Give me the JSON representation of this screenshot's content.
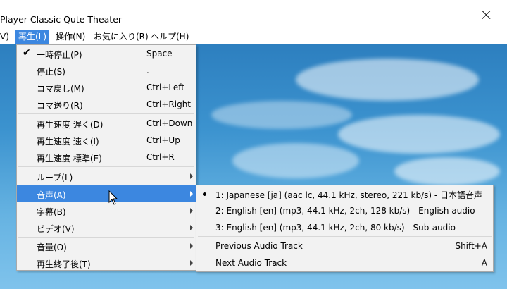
{
  "window": {
    "title": "Player Classic Qute Theater"
  },
  "menubar": {
    "items": [
      {
        "label": "V)",
        "active": false
      },
      {
        "label": "再生(L)",
        "active": true
      },
      {
        "label": "操作(N)",
        "active": false
      },
      {
        "label": "お気に入り(R)",
        "active": false
      },
      {
        "label": "ヘルプ(H)",
        "active": false
      }
    ]
  },
  "play_menu": {
    "items": [
      {
        "label": "一時停止(P)",
        "accel": "Space",
        "checked": true
      },
      {
        "label": "停止(S)",
        "accel": "."
      },
      {
        "label": "コマ戻し(M)",
        "accel": "Ctrl+Left"
      },
      {
        "label": "コマ送り(R)",
        "accel": "Ctrl+Right"
      },
      {
        "label": "再生速度 遅く(D)",
        "accel": "Ctrl+Down"
      },
      {
        "label": "再生速度 速く(I)",
        "accel": "Ctrl+Up"
      },
      {
        "label": "再生速度 標準(E)",
        "accel": "Ctrl+R"
      },
      {
        "label": "ループ(L)",
        "submenu": true
      },
      {
        "label": "音声(A)",
        "submenu": true,
        "highlighted": true
      },
      {
        "label": "字幕(B)",
        "submenu": true
      },
      {
        "label": "ビデオ(V)",
        "submenu": true
      },
      {
        "label": "音量(O)",
        "submenu": true
      },
      {
        "label": "再生終了後(T)",
        "submenu": true
      }
    ]
  },
  "audio_menu": {
    "tracks": [
      {
        "label": "1: Japanese [ja] (aac lc, 44.1 kHz, stereo, 221 kb/s) - 日本語音声",
        "selected": true
      },
      {
        "label": "2: English [en] (mp3, 44.1 kHz, 2ch, 128 kb/s) - English audio"
      },
      {
        "label": "3: English [en] (mp3, 44.1 kHz, 2ch, 80 kb/s) - Sub-audio"
      }
    ],
    "actions": [
      {
        "label": "Previous Audio Track",
        "accel": "Shift+A"
      },
      {
        "label": "Next Audio Track",
        "accel": "A"
      }
    ]
  },
  "colors": {
    "highlight": "#3c87e0",
    "menu_bg": "#f2f2f2",
    "sky": "#3c93cf"
  }
}
